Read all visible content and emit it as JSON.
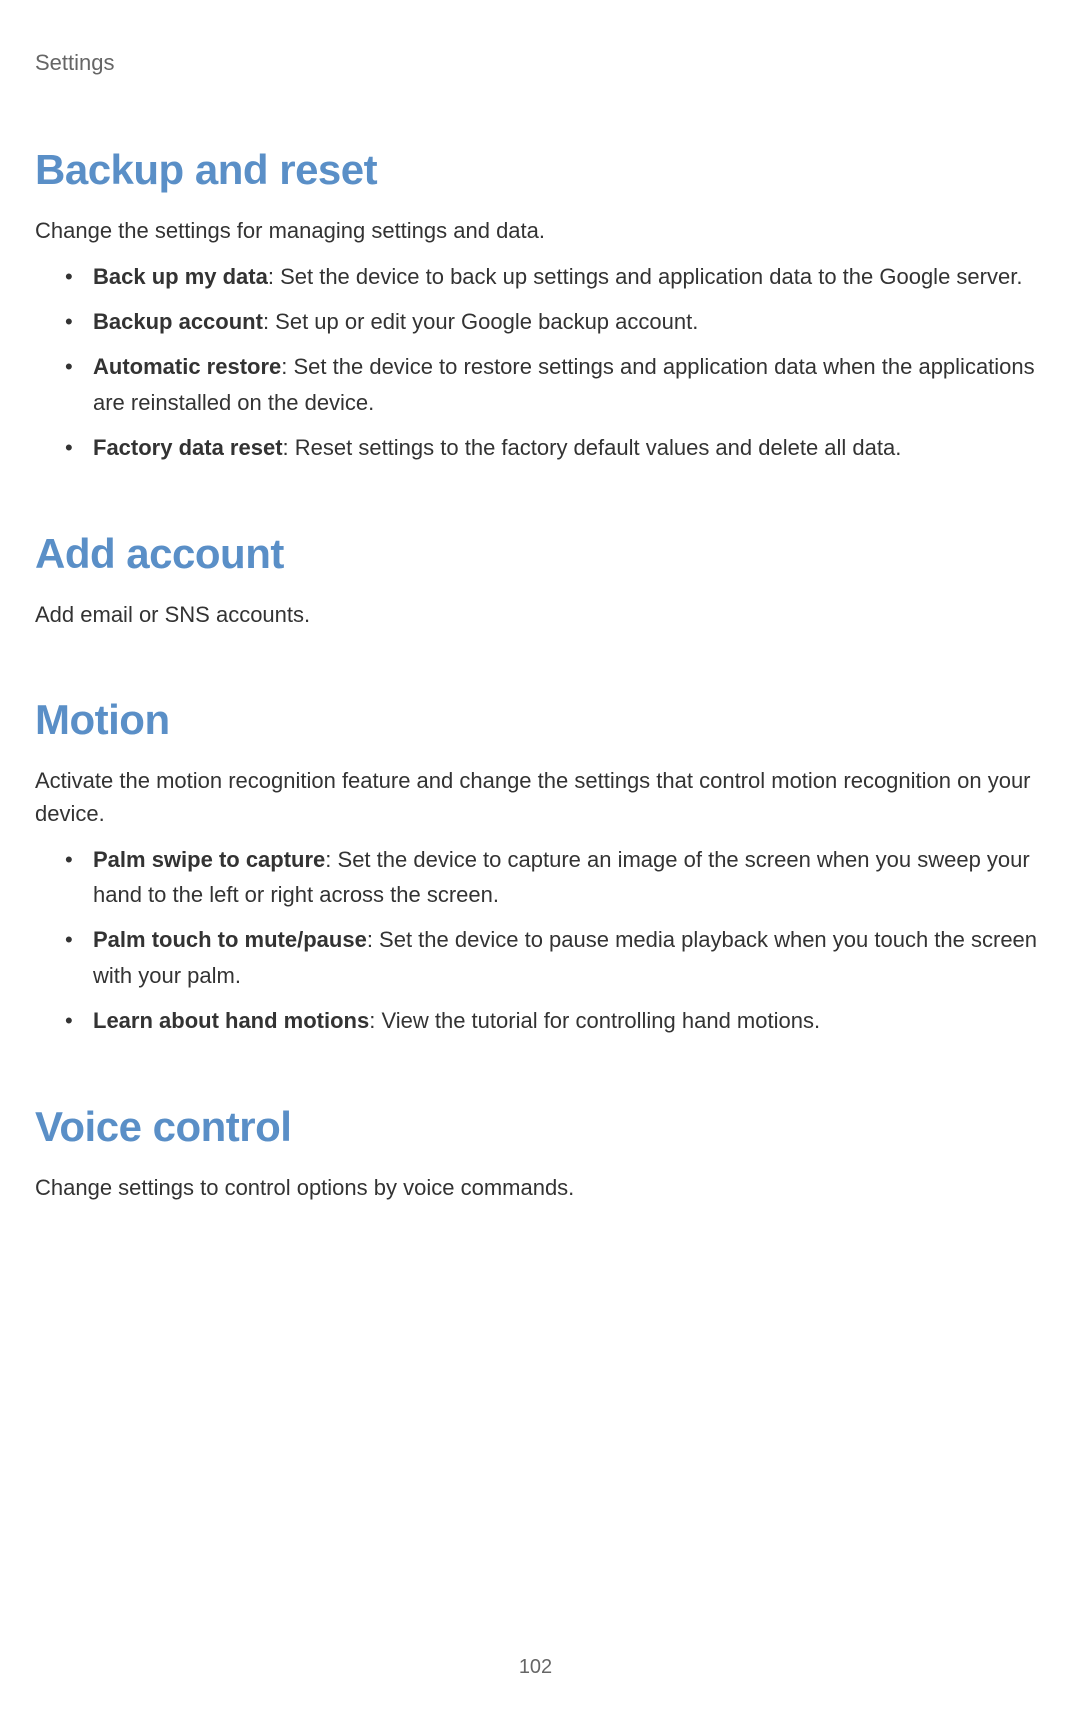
{
  "breadcrumb": "Settings",
  "sections": {
    "backup": {
      "heading": "Backup and reset",
      "intro": "Change the settings for managing settings and data.",
      "items": [
        {
          "term": "Back up my data",
          "desc": ": Set the device to back up settings and application data to the Google server."
        },
        {
          "term": "Backup account",
          "desc": ": Set up or edit your Google backup account."
        },
        {
          "term": "Automatic restore",
          "desc": ": Set the device to restore settings and application data when the applications are reinstalled on the device."
        },
        {
          "term": "Factory data reset",
          "desc": ": Reset settings to the factory default values and delete all data."
        }
      ]
    },
    "addaccount": {
      "heading": "Add account",
      "intro": "Add email or SNS accounts."
    },
    "motion": {
      "heading": "Motion",
      "intro": "Activate the motion recognition feature and change the settings that control motion recognition on your device.",
      "items": [
        {
          "term": "Palm swipe to capture",
          "desc": ": Set the device to capture an image of the screen when you sweep your hand to the left or right across the screen."
        },
        {
          "term": "Palm touch to mute/pause",
          "desc": ": Set the device to pause media playback when you touch the screen with your palm."
        },
        {
          "term": "Learn about hand motions",
          "desc": ": View the tutorial for controlling hand motions."
        }
      ]
    },
    "voice": {
      "heading": "Voice control",
      "intro": "Change settings to control options by voice commands."
    }
  },
  "pageNumber": "102"
}
